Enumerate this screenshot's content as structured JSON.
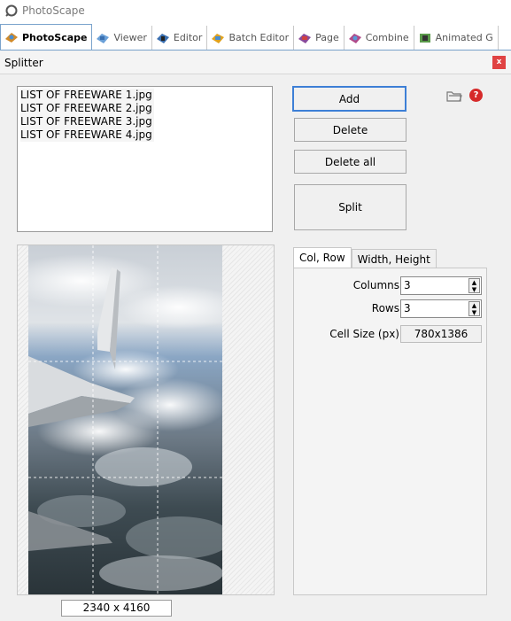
{
  "window": {
    "title": "PhotoScape"
  },
  "tabs": [
    {
      "label": "PhotoScape",
      "icon": "photoscape-icon",
      "active": true
    },
    {
      "label": "Viewer",
      "icon": "viewer-icon",
      "active": false
    },
    {
      "label": "Editor",
      "icon": "editor-icon",
      "active": false
    },
    {
      "label": "Batch Editor",
      "icon": "batch-editor-icon",
      "active": false
    },
    {
      "label": "Page",
      "icon": "page-icon",
      "active": false
    },
    {
      "label": "Combine",
      "icon": "combine-icon",
      "active": false
    },
    {
      "label": "Animated G",
      "icon": "animated-gif-icon",
      "active": false
    }
  ],
  "splitter": {
    "title": "Splitter",
    "close_label": "x"
  },
  "files": [
    "LIST OF FREEWARE 1.jpg",
    "LIST OF FREEWARE 2.jpg",
    "LIST OF FREEWARE 3.jpg",
    "LIST OF FREEWARE 4.jpg"
  ],
  "buttons": {
    "add": "Add",
    "delete": "Delete",
    "delete_all": "Delete all",
    "split": "Split"
  },
  "icons": {
    "folder": "folder-icon",
    "help": "help-icon",
    "help_glyph": "?"
  },
  "preview": {
    "size_label": "2340 x 4160",
    "grid_columns": 3,
    "grid_rows": 3
  },
  "settings_tabs": {
    "col_row": "Col, Row",
    "width_height": "Width, Height"
  },
  "settings": {
    "columns_label": "Columns",
    "columns_value": "3",
    "rows_label": "Rows",
    "rows_value": "3",
    "cell_size_label": "Cell Size (px)",
    "cell_size_value": "780x1386"
  },
  "colors": {
    "accent": "#3d7fd6",
    "close": "#e04343"
  }
}
